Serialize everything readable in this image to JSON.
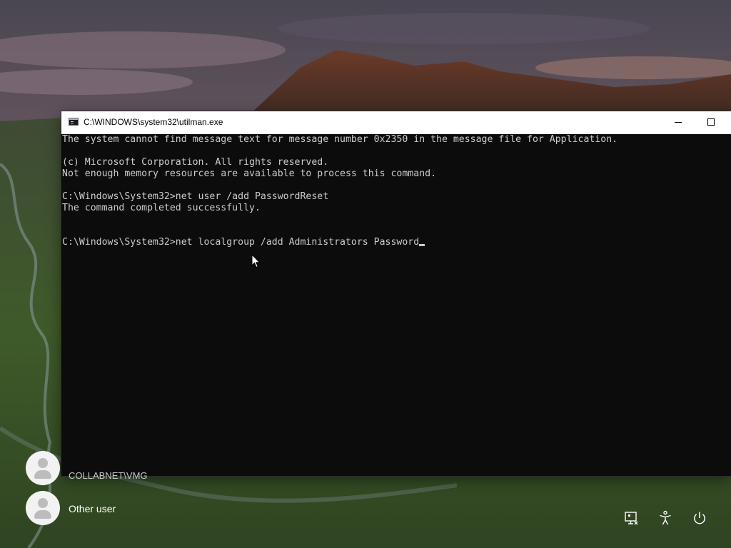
{
  "console": {
    "title": "C:\\WINDOWS\\system32\\utilman.exe",
    "lines": [
      "The system cannot find message text for message number 0x2350 in the message file for Application.",
      "",
      "(c) Microsoft Corporation. All rights reserved.",
      "Not enough memory resources are available to process this command.",
      "",
      "C:\\Windows\\System32>net user /add PasswordReset",
      "The command completed successfully.",
      "",
      "",
      "C:\\Windows\\System32>net localgroup /add Administrators Password"
    ],
    "buttons": {
      "minimize_icon": "minimize-icon",
      "maximize_icon": "maximize-icon"
    }
  },
  "login": {
    "users": [
      {
        "name": "COLLABNET\\VMG",
        "avatar_icon": "user-avatar-icon"
      },
      {
        "name": "Other user",
        "avatar_icon": "user-avatar-icon"
      }
    ]
  },
  "system_icons": [
    "network-icon",
    "accessibility-icon",
    "power-icon"
  ],
  "colors": {
    "console_background": "#0c0c0c",
    "console_text": "#cccccc",
    "titlebar": "#ffffff"
  }
}
